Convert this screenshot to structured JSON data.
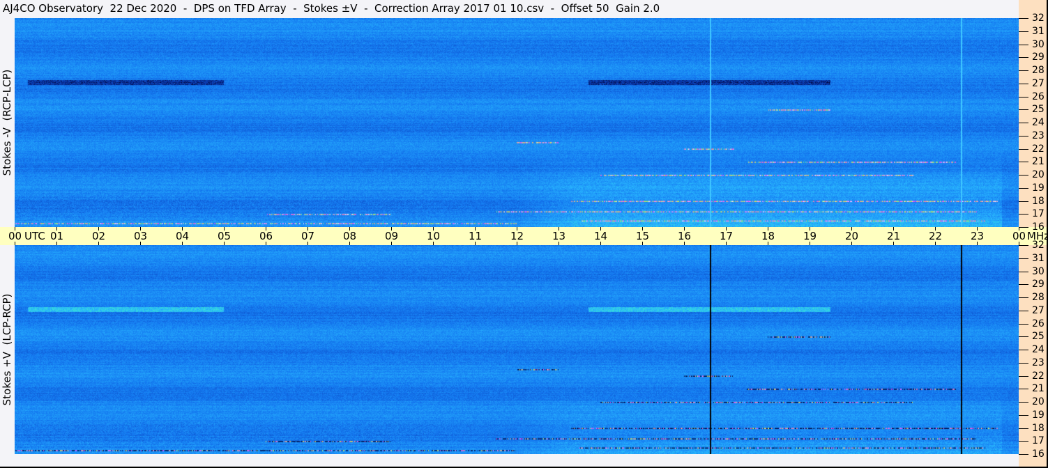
{
  "title": "AJ4CO Observatory  22 Dec 2020  -  DPS on TFD Array  -  Stokes ±V  -  Correction Array 2017 01 10.csv  -  Offset 50  Gain 2.0",
  "chart_data": [
    {
      "type": "heatmap",
      "panel": "top",
      "ylabel": "Stokes -V  (RCP-LCP)",
      "x_range_utc_hours": [
        0,
        24
      ],
      "y_range_mhz": [
        16,
        32
      ],
      "vertical_lines_utc": [
        16.62,
        22.62
      ],
      "vertical_line_color": "#40c8ff"
    },
    {
      "type": "heatmap",
      "panel": "bottom",
      "ylabel": "Stokes +V  (LCP-RCP)",
      "x_range_utc_hours": [
        0,
        24
      ],
      "y_range_mhz": [
        16,
        32
      ],
      "vertical_lines_utc": [
        16.62,
        22.62
      ],
      "vertical_line_color": "#000000"
    }
  ],
  "x_axis": {
    "unit_label_start": "UTC",
    "unit_label_end": "MHz",
    "tick_labels": [
      "00",
      "01",
      "02",
      "03",
      "04",
      "05",
      "06",
      "07",
      "08",
      "09",
      "10",
      "11",
      "12",
      "13",
      "14",
      "15",
      "16",
      "17",
      "18",
      "19",
      "20",
      "21",
      "22",
      "23",
      "00"
    ]
  },
  "y_axis": {
    "tick_labels": [
      "32",
      "31",
      "30",
      "29",
      "28",
      "27",
      "26",
      "25",
      "24",
      "23",
      "22",
      "21",
      "20",
      "19",
      "18",
      "17",
      "16"
    ]
  },
  "colors": {
    "background": "#f4f4f8",
    "time_axis": "#ffffc0",
    "freq_axis": "#fde0c0",
    "colormap": [
      "#000030",
      "#0a3cb4",
      "#1478f0",
      "#28b4ff",
      "#3cf0c8",
      "#f0f03c",
      "#ff3cff",
      "#ffffff"
    ]
  }
}
